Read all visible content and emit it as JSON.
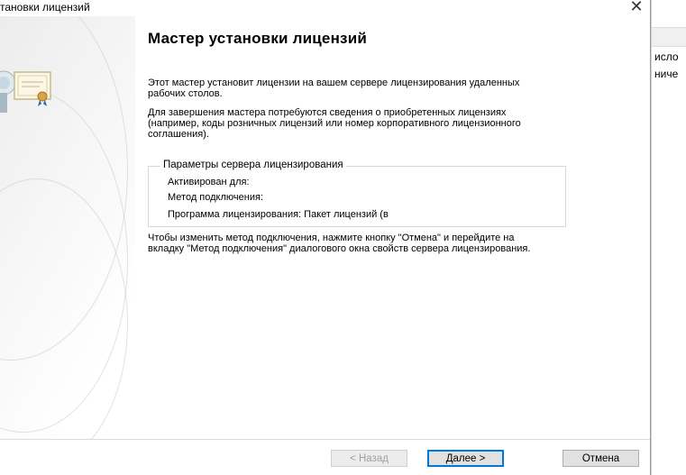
{
  "window": {
    "title": "тановки лицензий",
    "close_glyph": "✕"
  },
  "background_window": {
    "text1": "исло",
    "text2": "ниче"
  },
  "wizard": {
    "heading": "Мастер установки лицензий",
    "intro": "Этот мастер установит лицензии на вашем сервере лицензирования удаленных рабочих столов.",
    "requirement": "Для завершения мастера потребуются сведения о приобретенных лицензиях (например, коды розничных лицензий или номер корпоративного лицензионного соглашения).",
    "group": {
      "legend": "Параметры сервера лицензирования",
      "activated_for": "Активирован для:",
      "connection_method": "Метод подключения:",
      "licensing_program": "Программа лицензирования: Пакет лицензий (в"
    },
    "change_note": "Чтобы изменить метод подключения, нажмите кнопку \"Отмена\" и перейдите на вкладку \"Метод подключения\" диалогового окна свойств сервера лицензирования."
  },
  "buttons": {
    "back": "< Назад",
    "next": "Далее >",
    "cancel": "Отмена"
  },
  "icons": {
    "license_certificate": "certificate-icon"
  }
}
